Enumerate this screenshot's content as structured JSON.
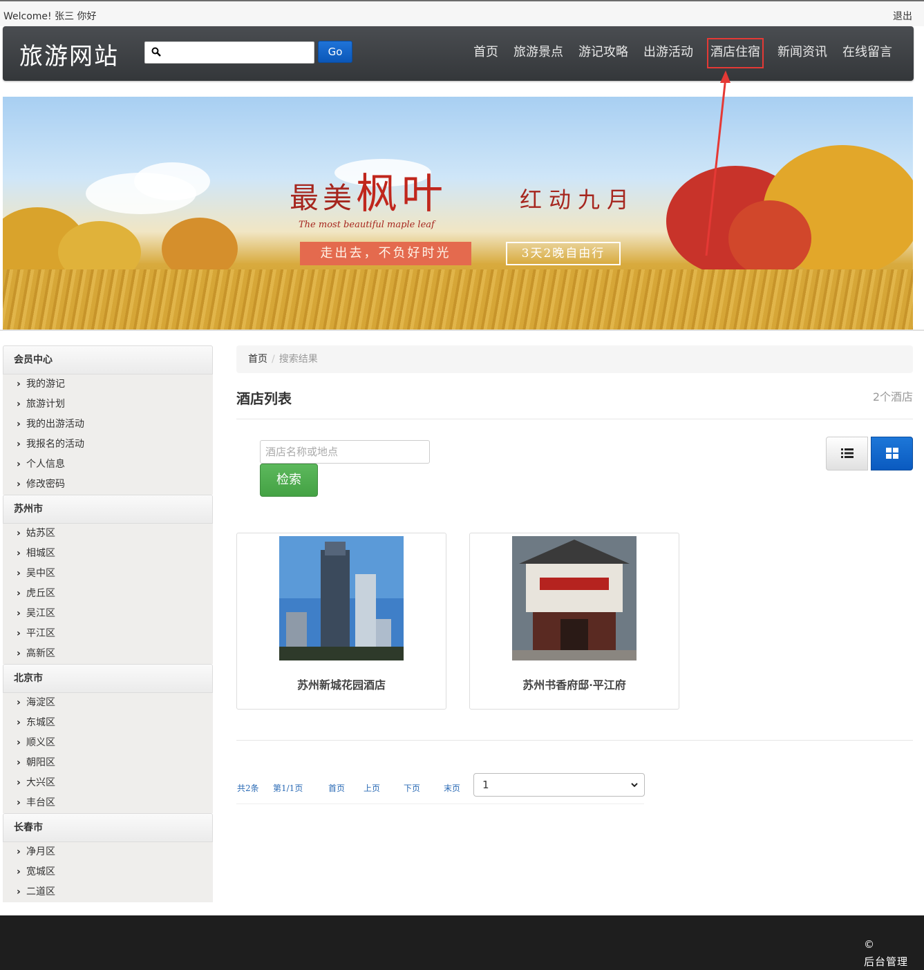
{
  "header": {
    "welcome": "Welcome! 张三 你好",
    "logout": "退出"
  },
  "navbar": {
    "brand": "旅游网站",
    "search_placeholder": "",
    "go_label": "Go",
    "menu": [
      "首页",
      "旅游景点",
      "游记攻略",
      "出游活动",
      "酒店住宿",
      "新闻资讯",
      "在线留言"
    ],
    "highlighted_item": "酒店住宿"
  },
  "banner": {
    "title_part1": "最美",
    "title_part2": "枫叶",
    "title_part3": "红动九月",
    "subtitle_en": "The most beautiful maple leaf",
    "tag1": "走出去，不负好时光",
    "tag2": "3天2晚自由行"
  },
  "sidebar": {
    "sections": [
      {
        "title": "会员中心",
        "items": [
          "我的游记",
          "旅游计划",
          "我的出游活动",
          "我报名的活动",
          "个人信息",
          "修改密码"
        ]
      },
      {
        "title": "苏州市",
        "items": [
          "姑苏区",
          "相城区",
          "吴中区",
          "虎丘区",
          "吴江区",
          "平江区",
          "高新区"
        ]
      },
      {
        "title": "北京市",
        "items": [
          "海淀区",
          "东城区",
          "顺义区",
          "朝阳区",
          "大兴区",
          "丰台区"
        ]
      },
      {
        "title": "长春市",
        "items": [
          "净月区",
          "宽城区",
          "二道区"
        ]
      }
    ]
  },
  "breadcrumb": {
    "home": "首页",
    "current": "搜索结果"
  },
  "main": {
    "title": "酒店列表",
    "count": "2个酒店",
    "filter_placeholder": "酒店名称或地点",
    "search_button": "检索",
    "hotels": [
      {
        "name": "苏州新城花园酒店"
      },
      {
        "name": "苏州书香府邸·平江府"
      }
    ]
  },
  "pager": {
    "total": "共2条",
    "page": "第1/1页",
    "first": "首页",
    "prev": "上页",
    "next": "下页",
    "last": "末页",
    "select_value": "1"
  },
  "footer": {
    "copyright": "©",
    "admin": "后台管理"
  },
  "colors": {
    "nav_bg": "#3d4044",
    "go_blue": "#0b57b8",
    "search_green": "#5cb85c",
    "highlight_red": "#e53935",
    "footer_bg": "#1e1e1e"
  }
}
